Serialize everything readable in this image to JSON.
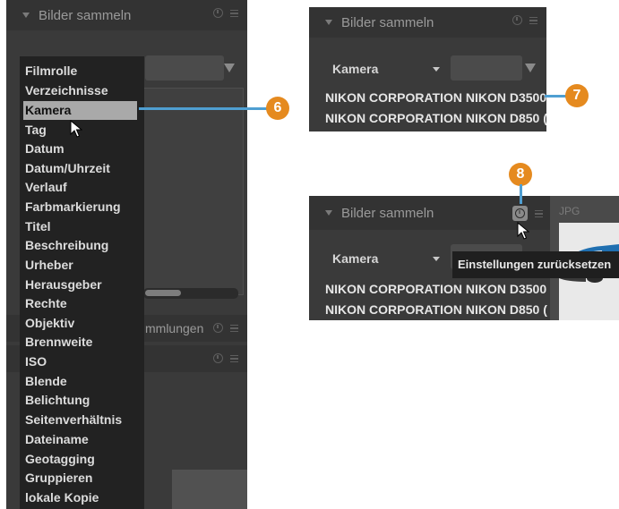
{
  "module_title": "Bilder sammeln",
  "dropdown_items": [
    "Filmrolle",
    "Verzeichnisse",
    "Kamera",
    "Tag",
    "Datum",
    "Datum/Uhrzeit",
    "Verlauf",
    "Farbmarkierung",
    "Titel",
    "Beschreibung",
    "Urheber",
    "Herausgeber",
    "Rechte",
    "Objektiv",
    "Brennweite",
    "ISO",
    "Blende",
    "Belichtung",
    "Seitenverhältnis",
    "Dateiname",
    "Geotagging",
    "Gruppieren",
    "lokale Kopie"
  ],
  "selected_item": "Kamera",
  "background_panel_fragment": "mmlungen",
  "camera_selector_label": "Kamera",
  "camera_results": [
    "NIKON CORPORATION NIKON D3500",
    "NIKON CORPORATION NIKON D850 ("
  ],
  "tooltip_text": "Einstellungen zurücksetzen",
  "thumbnail_label": "JPG",
  "callouts": [
    "6",
    "7",
    "8"
  ],
  "colors": {
    "panel_bg": "#3a3a3a",
    "header_bg": "#333333",
    "dropdown_bg": "#222222",
    "selection_bg": "#a9a9a9",
    "callout_line": "#4f9fd2",
    "callout_badge": "#e58a1f"
  },
  "icons": [
    "reset-icon",
    "menu-icon",
    "expand-triangle-icon",
    "dropdown-caret-icon",
    "mouse-cursor-icon"
  ]
}
